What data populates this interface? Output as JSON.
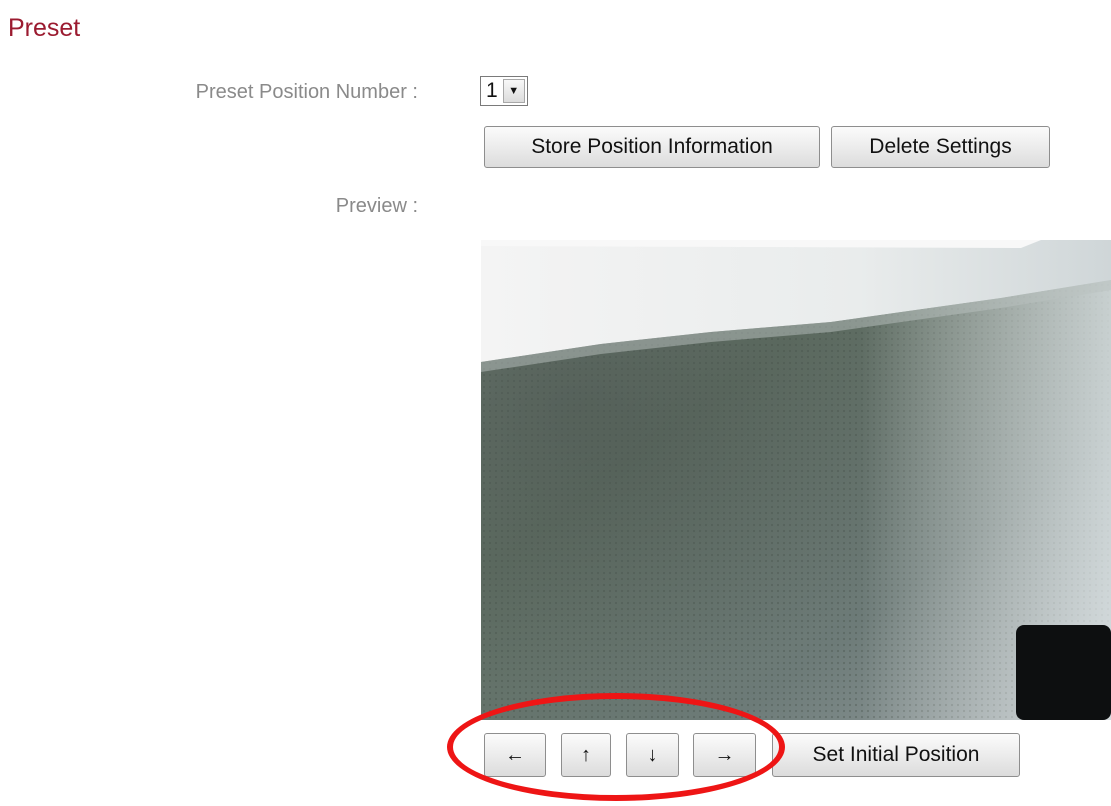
{
  "section": {
    "title": "Preset"
  },
  "preset": {
    "label": "Preset Position Number :",
    "selected_value": "1"
  },
  "buttons": {
    "store": "Store Position Information",
    "delete": "Delete Settings",
    "set_initial": "Set Initial Position"
  },
  "preview": {
    "label": "Preview :"
  },
  "arrows": {
    "left": "←",
    "up": "↑",
    "down": "↓",
    "right": "→"
  },
  "colors": {
    "section_title": "#9b1b30",
    "label_gray": "#8a8a8a",
    "highlight": "#ee1515"
  }
}
